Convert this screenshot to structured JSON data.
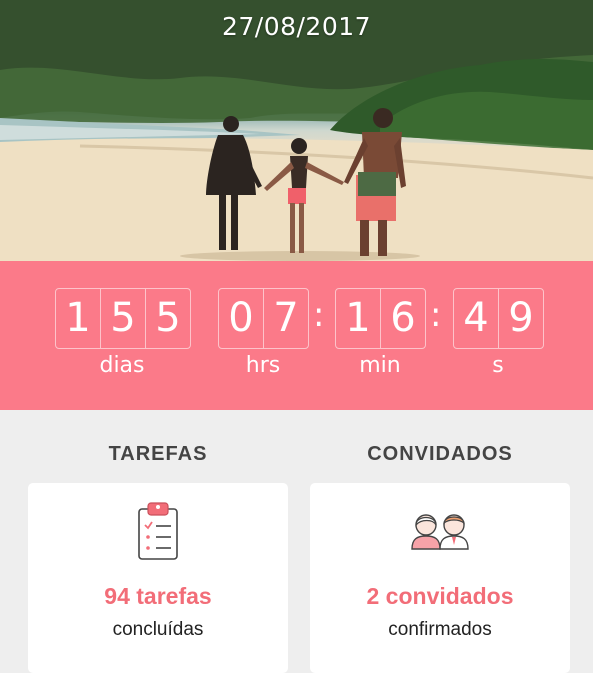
{
  "header": {
    "date": "27/08/2017"
  },
  "countdown": {
    "days": [
      "1",
      "5",
      "5"
    ],
    "hours": [
      "0",
      "7"
    ],
    "minutes": [
      "1",
      "6"
    ],
    "seconds": [
      "4",
      "9"
    ],
    "separator": ":",
    "labels": {
      "days": "dias",
      "hours": "hrs",
      "minutes": "min",
      "seconds": "s"
    }
  },
  "tasks": {
    "title": "TAREFAS",
    "count": "94 tarefas",
    "status": "concluídas",
    "icon": "clipboard-checklist-icon"
  },
  "guests": {
    "title": "CONVIDADOS",
    "count": "2 convidados",
    "status": "confirmados",
    "icon": "couple-icon"
  },
  "colors": {
    "accent": "#fb7a89",
    "accent_text": "#f26d78",
    "background": "#eeeeee"
  }
}
